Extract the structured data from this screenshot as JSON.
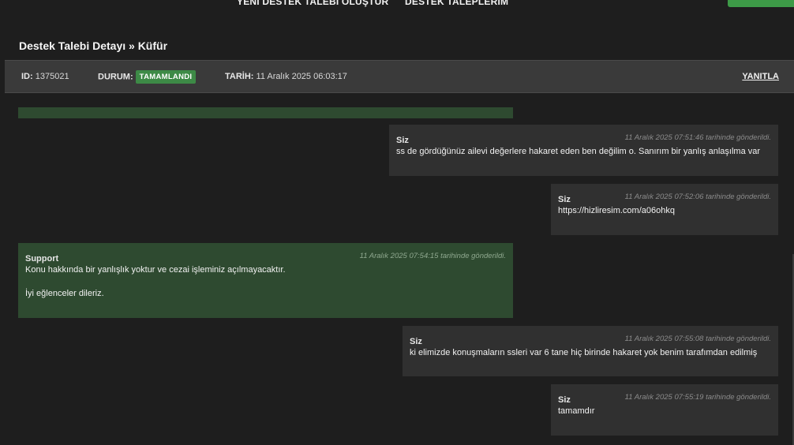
{
  "nav": {
    "create_ticket": "YENİ DESTEK TALEBİ OLUŞTUR",
    "my_tickets": "DESTEK TALEPLERİM"
  },
  "page": {
    "title": "Destek Talebi Detayı » Küfür"
  },
  "ticket": {
    "id_label": "ID:",
    "id_value": "1375021",
    "status_label": "DURUM:",
    "status_value": "TAMAMLANDI",
    "date_label": "TARİH:",
    "date_value": "11 Aralık 2025 06:03:17",
    "reply_label": "YANITLA"
  },
  "colors": {
    "background": "#1e1e1e",
    "user_bubble": "#303030",
    "support_bubble": "#2e4a30",
    "status_badge": "#3d8a46"
  },
  "messages": [
    {
      "author": "Siz",
      "time": "11 Aralık 2025 07:51:46 tarihinde gönderildi.",
      "lines": [
        "ss de gördüğünüz ailevi değerlere hakaret eden ben değilim o. Sanırım bir yanlış anlaşılma var"
      ]
    },
    {
      "author": "Siz",
      "time": "11 Aralık 2025 07:52:06 tarihinde gönderildi.",
      "lines": [
        "https://hizliresim.com/a06ohkq"
      ]
    },
    {
      "author": "Support",
      "time": "11 Aralık 2025 07:54:15 tarihinde gönderildi.",
      "lines": [
        "Konu hakkında bir yanlışlık yoktur ve cezai işleminiz açılmayacaktır.",
        "İyi eğlenceler dileriz."
      ]
    },
    {
      "author": "Siz",
      "time": "11 Aralık 2025 07:55:08 tarihinde gönderildi.",
      "lines": [
        "ki elimizde konuşmaların ssleri var 6 tane hiç birinde hakaret yok benim tarafımdan edilmiş"
      ]
    },
    {
      "author": "Siz",
      "time": "11 Aralık 2025 07:55:19 tarihinde gönderildi.",
      "lines": [
        "tamamdır"
      ]
    }
  ]
}
